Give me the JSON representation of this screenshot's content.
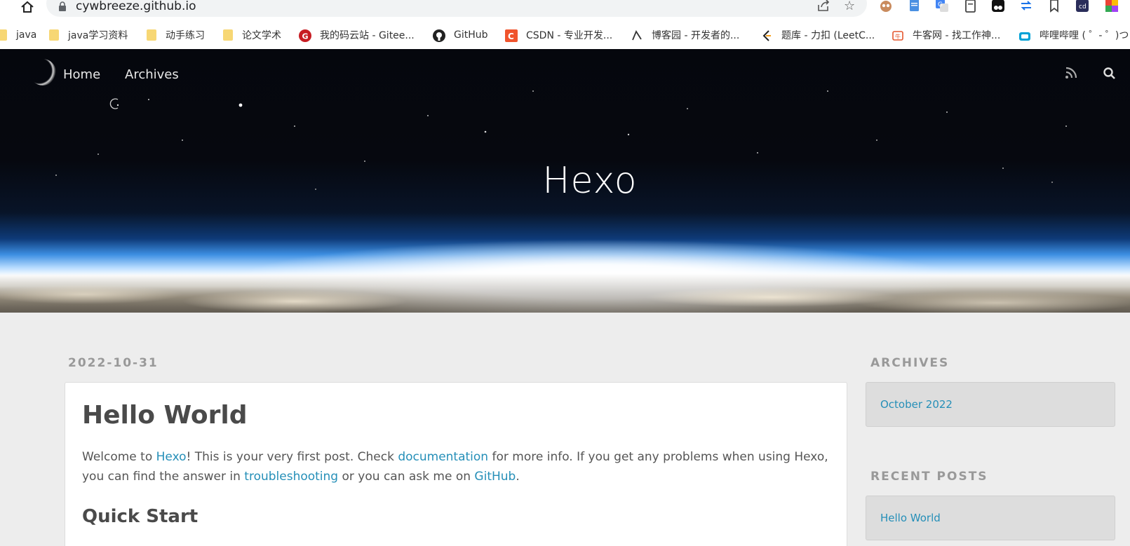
{
  "browser": {
    "url": "cywbreeze.github.io",
    "bookmarks": [
      {
        "label": "java",
        "icon": "folder-icon"
      },
      {
        "label": "java学习资料",
        "icon": "folder-icon"
      },
      {
        "label": "动手练习",
        "icon": "folder-icon"
      },
      {
        "label": "论文学术",
        "icon": "folder-icon"
      },
      {
        "label": "我的码云站 - Gitee...",
        "icon": "gitee-icon"
      },
      {
        "label": "GitHub",
        "icon": "github-icon"
      },
      {
        "label": "CSDN - 专业开发...",
        "icon": "csdn-icon"
      },
      {
        "label": "博客园 - 开发者的...",
        "icon": "cnblogs-icon"
      },
      {
        "label": "题库 - 力扣 (LeetC...",
        "icon": "leetcode-icon"
      },
      {
        "label": "牛客网 - 找工作神...",
        "icon": "nowcoder-icon"
      },
      {
        "label": "哔哩哔哩 ( ゜- ゜)つ",
        "icon": "bilibili-icon"
      }
    ]
  },
  "site": {
    "nav": [
      {
        "label": "Home"
      },
      {
        "label": "Archives"
      }
    ],
    "title": "Hexo"
  },
  "post": {
    "date": "2022-10-31",
    "title": "Hello World",
    "intro_1": "Welcome to ",
    "link_hexo": "Hexo",
    "intro_2": "! This is your very first post. Check ",
    "link_docs": "documentation",
    "intro_3": " for more info. If you get any problems when using Hexo, you can find the answer in ",
    "link_troubleshooting": "troubleshooting",
    "intro_4": " or you can ask me on ",
    "link_github": "GitHub",
    "intro_5": ".",
    "section_heading": "Quick Start"
  },
  "sidebar": {
    "archives_title": "ARCHIVES",
    "archives_items": [
      "October 2022"
    ],
    "recent_title": "RECENT POSTS",
    "recent_items": [
      "Hello World"
    ]
  }
}
